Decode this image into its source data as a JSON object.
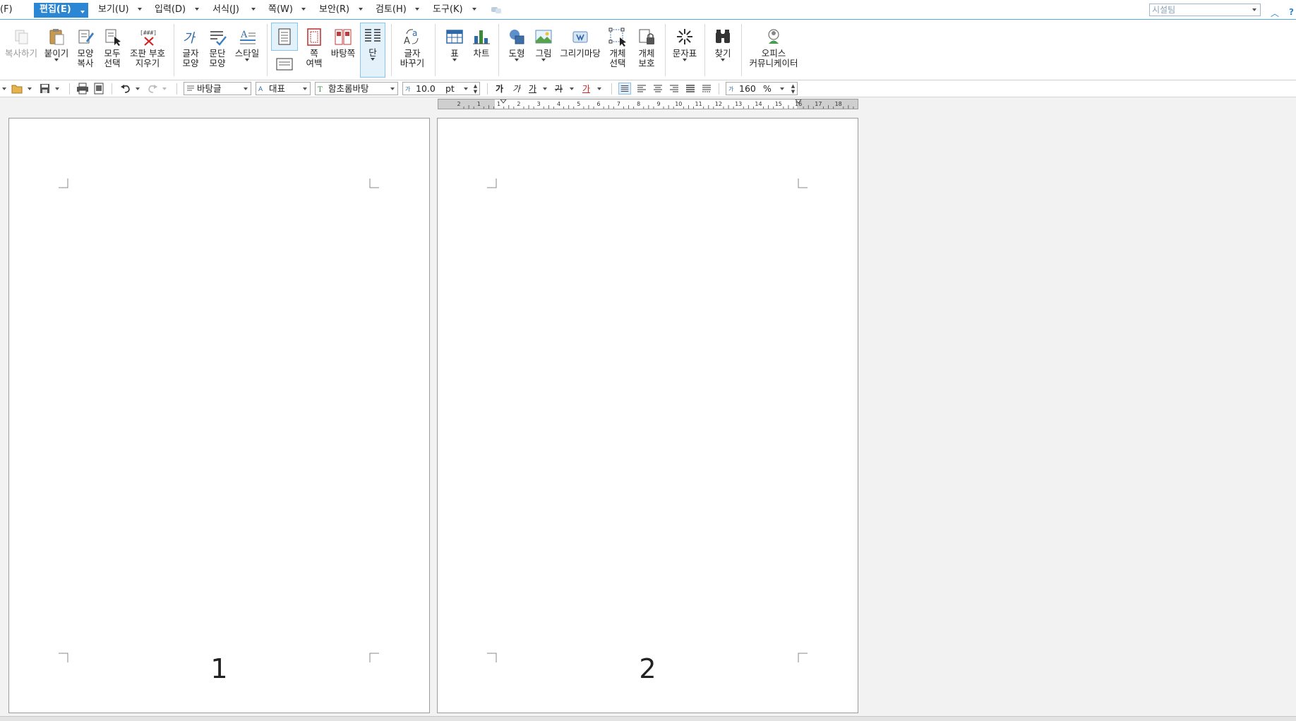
{
  "menu": {
    "file": "(F)",
    "edit": "편집(E)",
    "view": "보기(U)",
    "insert": "입력(D)",
    "format": "서식(J)",
    "page": "쪽(W)",
    "security": "보안(R)",
    "review": "검토(H)",
    "tools": "도구(K)",
    "search_placeholder": "시설팀"
  },
  "ribbon": {
    "copy": "복사하기",
    "paste": "붙이기",
    "format_copy": "모양\n복사",
    "select_all": "모두\n선택",
    "clear_marks": "조판 부호\n지우기",
    "char_shape": "글자\n모양",
    "para_shape": "문단\n모양",
    "style": "스타일",
    "margin": "쪽\n여백",
    "background": "바탕쪽",
    "columns": "단",
    "replace": "글자\n바꾸기",
    "table": "표",
    "chart": "차트",
    "shape": "도형",
    "picture": "그림",
    "draw_market": "그리기마당",
    "object_select": "개체\n선택",
    "object_protect": "개체\n보호",
    "char_map": "문자표",
    "find": "찾기",
    "office_comm": "오피스\n커뮤니케이터"
  },
  "toolbar": {
    "style_name": "바탕글",
    "lang": "대표",
    "font": "함초롬바탕",
    "size": "10.0",
    "unit": "pt",
    "bold": "가",
    "italic": "가",
    "underline": "가",
    "strike": "가",
    "color": "가",
    "line_spacing": "160",
    "spacing_unit": "%"
  },
  "ruler": {
    "labels": [
      "2",
      "1",
      "1",
      "2",
      "3",
      "4",
      "5",
      "6",
      "7",
      "8",
      "9",
      "10",
      "11",
      "12",
      "13",
      "14",
      "15",
      "16",
      "17",
      "18"
    ]
  },
  "pages": [
    {
      "number": "1"
    },
    {
      "number": "2"
    }
  ],
  "colors": {
    "accent": "#2b87d3",
    "page_bg": "#ffffff",
    "workspace": "#f2f2f2"
  }
}
